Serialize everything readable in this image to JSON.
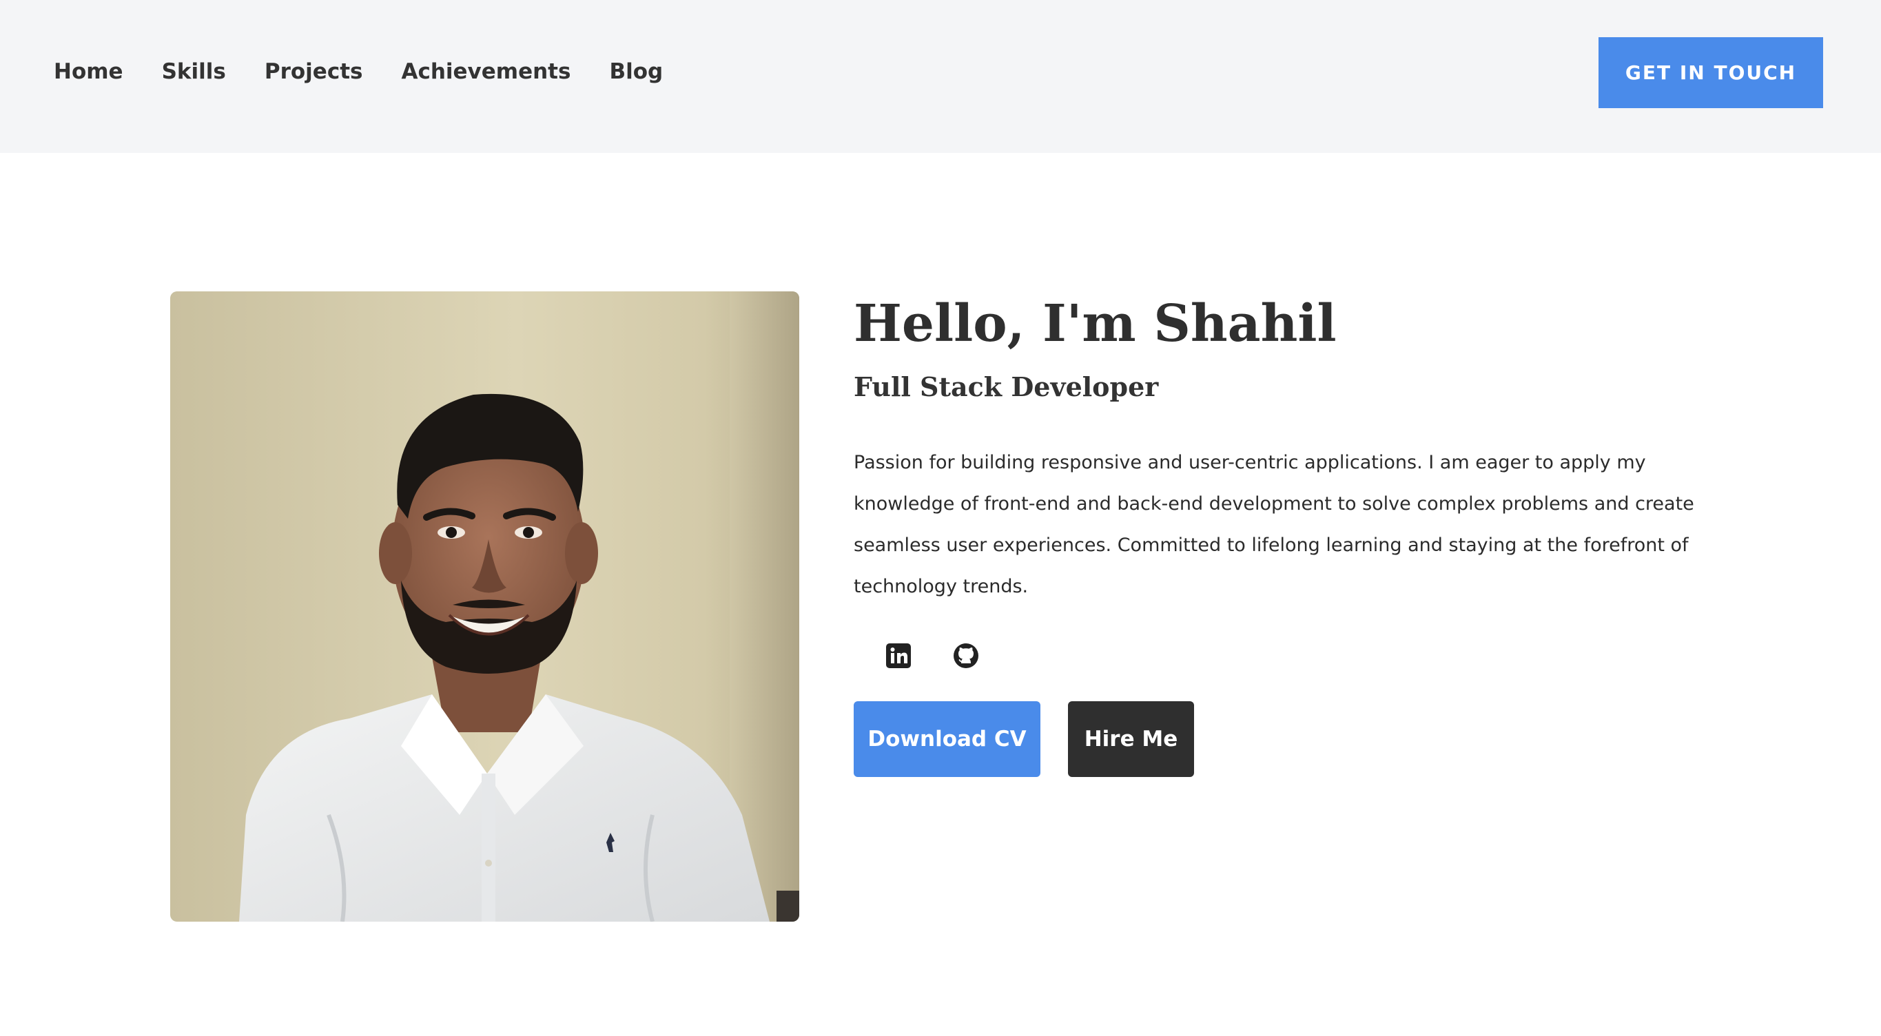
{
  "nav": {
    "links": [
      "Home",
      "Skills",
      "Projects",
      "Achievements",
      "Blog"
    ],
    "cta_label": "GET IN TOUCH"
  },
  "hero": {
    "title": "Hello, I'm Shahil",
    "subtitle": "Full Stack Developer",
    "bio": "Passion for building responsive and user-centric applications. I am eager to apply my knowledge of front-end and back-end development to solve complex problems and create seamless user experiences. Committed to lifelong learning and staying at the forefront of technology trends.",
    "socials": [
      {
        "icon": "linkedin-icon"
      },
      {
        "icon": "github-icon"
      }
    ],
    "primary_button": "Download CV",
    "secondary_button": "Hire Me"
  },
  "colors": {
    "accent": "#4a8bea",
    "dark": "#2f2f2f",
    "header_bg": "#f4f5f7"
  }
}
